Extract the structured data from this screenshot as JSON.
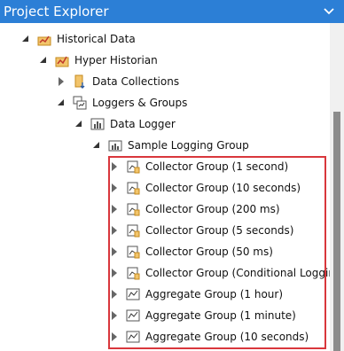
{
  "panel": {
    "title": "Project Explorer"
  },
  "tree": {
    "historical_data": "Historical Data",
    "hyper_historian": "Hyper Historian",
    "data_collections": "Data Collections",
    "loggers_groups": "Loggers & Groups",
    "data_logger": "Data Logger",
    "sample_logging_group": "Sample Logging Group",
    "groups": [
      "Collector Group (1 second)",
      "Collector Group (10 seconds)",
      "Collector Group (200 ms)",
      "Collector Group (5 seconds)",
      "Collector Group (50 ms)",
      "Collector Group (Conditional Logging)",
      "Aggregate Group (1 hour)",
      "Aggregate Group (1 minute)",
      "Aggregate Group (10 seconds)"
    ]
  },
  "colors": {
    "titlebar": "#2c7fd6",
    "highlight": "#d9373c",
    "scroll_thumb": "#8c8c8c"
  }
}
